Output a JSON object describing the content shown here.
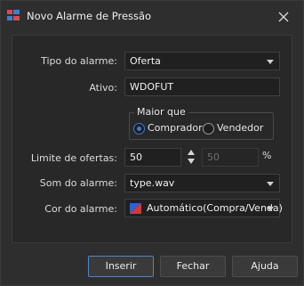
{
  "window": {
    "title": "Novo Alarme de Pressão"
  },
  "form": {
    "tipo_label": "Tipo do alarme:",
    "tipo_value": "Oferta",
    "ativo_label": "Ativo:",
    "ativo_value": "WDOFUT",
    "group_title": "Maior que",
    "radio_comprador": "Comprador",
    "radio_vendedor": "Vendedor",
    "selected_radio": "Comprador",
    "limite_label": "Limite de ofertas:",
    "limite_value": "50",
    "percent_value": "50",
    "percent_symbol": "%",
    "som_label": "Som do alarme:",
    "som_value": "type.wav",
    "cor_label": "Cor do alarme:",
    "cor_value": "Automático(Compra/Venda)"
  },
  "buttons": {
    "inserir": "Inserir",
    "fechar": "Fechar",
    "ajuda": "Ajuda"
  },
  "colors": {
    "accent": "#3d7bd6",
    "swatch_buy": "#2f5fd0",
    "swatch_sell": "#d23a3a"
  }
}
